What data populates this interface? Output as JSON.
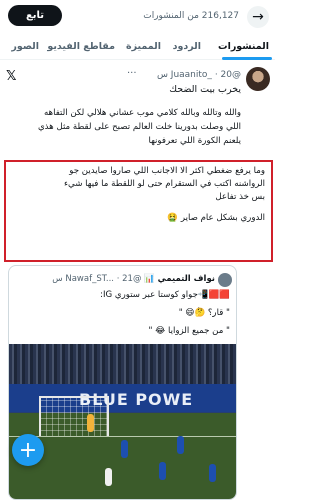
{
  "header": {
    "back_glyph": "→",
    "follower_count_text": "216,127 من المنشورات",
    "follow_label": "تابع"
  },
  "tabs": [
    {
      "label": "المنشورات",
      "active": true
    },
    {
      "label": "الردود",
      "active": false
    },
    {
      "label": "المميزة",
      "active": false
    },
    {
      "label": "مقاطع الفيديو",
      "active": false
    },
    {
      "label": "الصور",
      "active": false
    }
  ],
  "tweet": {
    "author_name": "",
    "handle": "@Juaanito_",
    "time": "20 س",
    "more_glyph": "···",
    "lines": [
      "يخرب بيت الضحك",
      "والله وتالله وبالله كلامي موب عشاني هلالي لكن التفاهه",
      "اللي وصلت بدورينا خلت العالم تصبح على لقطة مثل هذي",
      "يلعنم الكورة اللي تعرفونها",
      "وما يرفع ضغطي اكثر الا الاجانب اللي صاروا صايدين جو",
      "الرواشنه اكتب في الستقرام حتى لو اللقطة ما فيها شيء",
      "بس خذ تفاعل",
      "الدوري بشكل عام صاير 🤮"
    ]
  },
  "quote": {
    "author_name": "نواف التميمي 📊",
    "handle": "@Nawaf_ST...",
    "time": "21 س",
    "lines": [
      "🟥🟥📲جواو كوستا عبر ستوري IG:",
      "\" قار؟ 🤔😄 \"",
      "\" من جميع الزوايا 😂 \""
    ],
    "banner_text": "BLUE POWE"
  },
  "fab_glyph": "+",
  "x_glyph": "𝕏"
}
